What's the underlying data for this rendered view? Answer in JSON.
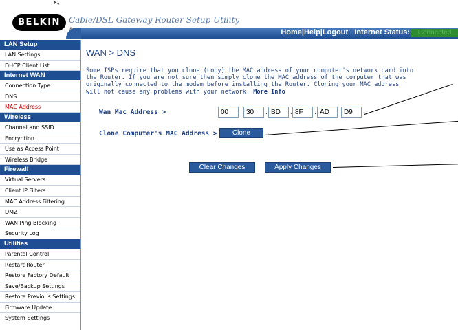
{
  "header": {
    "logo_text": "BELKIN",
    "logo_mark": "®",
    "app_title": "Cable/DSL Gateway Router Setup Utility",
    "nav": {
      "home": "Home",
      "help": "Help",
      "logout": "Logout",
      "status_label": "Internet Status:",
      "status_value": "Connected"
    }
  },
  "sidebar": {
    "sections": [
      {
        "title": "LAN Setup",
        "items": [
          "LAN Settings",
          "DHCP Client List"
        ]
      },
      {
        "title": "Internet WAN",
        "items": [
          "Connection Type",
          "DNS",
          "MAC Address"
        ]
      },
      {
        "title": "Wireless",
        "items": [
          "Channel and SSID",
          "Encryption",
          "Use as Access Point",
          "Wireless Bridge"
        ]
      },
      {
        "title": "Firewall",
        "items": [
          "Virtual Servers",
          "Client IP Filters",
          "MAC Address Filtering",
          "DMZ",
          "WAN Ping Blocking",
          "Security Log"
        ]
      },
      {
        "title": "Utilities",
        "items": [
          "Parental Control",
          "Restart Router",
          "Restore Factory Default",
          "Save/Backup Settings",
          "Restore Previous Settings",
          "Firmware Update",
          "System Settings"
        ]
      }
    ],
    "active_item": "MAC Address"
  },
  "main": {
    "title": "WAN > DNS",
    "description": "Some ISPs require that you clone (copy) the MAC address of your computer's network card into the Router. If you are not sure then simply clone the MAC address of the computer that was originally connected to the modem before installing the Router. Cloning your MAC address will not cause any problems with your network.",
    "more_info": "More Info",
    "wan_mac_label": "Wan Mac Address >",
    "mac_octets": [
      "00",
      "30",
      "BD",
      "8F",
      "AD",
      "D9"
    ],
    "clone_label": "Clone Computer's MAC Address >",
    "clone_button": "Clone",
    "clear_button": "Clear Changes",
    "apply_button": "Apply Changes"
  },
  "colors": {
    "nav_blue": "#1f4f92",
    "text_blue": "#1f3f7f",
    "active_red": "#cc0000",
    "status_green": "#2e8b2e"
  }
}
